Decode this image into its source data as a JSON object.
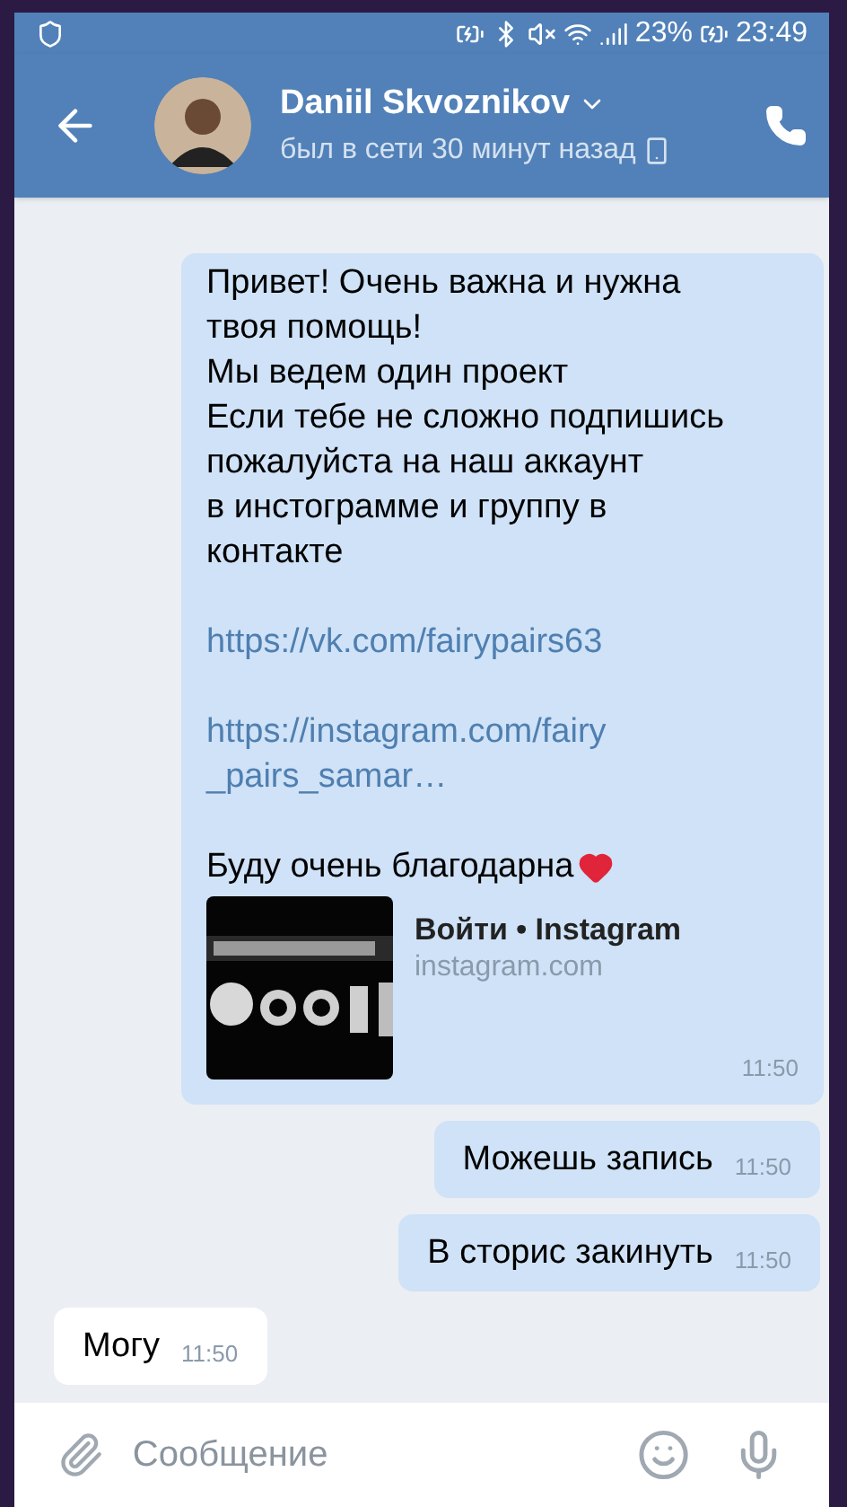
{
  "status_bar": {
    "battery": "23%",
    "time": "23:49"
  },
  "header": {
    "name": "Daniil Skvoznikov",
    "status": "был в сети 30 минут назад"
  },
  "messages": [
    {
      "kind": "post",
      "outgoing": true,
      "text": "Привет! Очень важна и нужна твоя помощь!\nМы ведем один проект\nЕсли тебе не сложно подпишись пожалуйста на наш аккаунт\nв инстограмме и группу в контакте",
      "links": [
        "https://vk.com/fairypairs63",
        "https://instagram.com/fairy_pairs_samar…"
      ],
      "closing": "Буду очень благодарна",
      "preview": {
        "kind": "picture",
        "title": "Войти • Instagram",
        "domain": "instagram.com"
      },
      "time": "11:50"
    },
    {
      "kind": "text",
      "outgoing": true,
      "text": "Можешь запись",
      "time": "11:50"
    },
    {
      "kind": "text",
      "outgoing": true,
      "text": "В сторис закинуть",
      "time": "11:50"
    },
    {
      "kind": "text",
      "outgoing": false,
      "text": "Могу",
      "time": "11:50"
    }
  ],
  "composer": {
    "placeholder": "Сообщение"
  }
}
